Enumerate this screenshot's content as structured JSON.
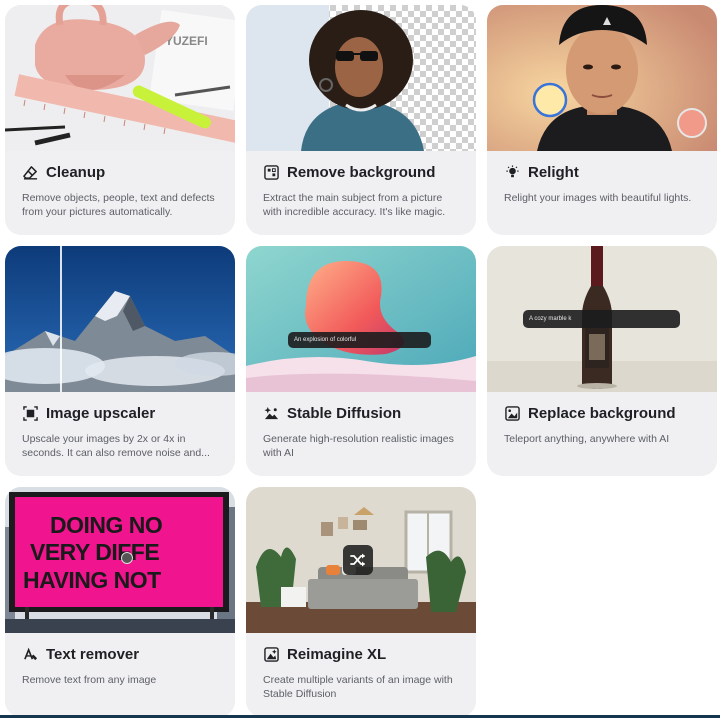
{
  "tools": [
    {
      "title": "Cleanup",
      "icon": "eraser-icon",
      "description": "Remove objects, people, text and defects from your pictures automatically."
    },
    {
      "title": "Remove background",
      "icon": "background-remove-icon",
      "description": "Extract the main subject from a picture with incredible accuracy. It's like magic."
    },
    {
      "title": "Relight",
      "icon": "lightbulb-icon",
      "description": "Relight your images with beautiful lights."
    },
    {
      "title": "Image upscaler",
      "icon": "upscale-icon",
      "description": "Upscale your images by 2x or 4x in seconds. It can also remove noise and..."
    },
    {
      "title": "Stable Diffusion",
      "icon": "image-sparkle-icon",
      "description": "Generate high-resolution realistic images with AI",
      "prompt": "An explosion of colorful"
    },
    {
      "title": "Replace background",
      "icon": "image-replace-icon",
      "description": "Teleport anything, anywhere with AI",
      "prompt": "A cozy marble k"
    },
    {
      "title": "Text remover",
      "icon": "text-erase-icon",
      "description": "Remove text from any image",
      "billboard": [
        "DOING NO",
        "VERY DIFFE",
        "HAVING NOT"
      ]
    },
    {
      "title": "Reimagine XL",
      "icon": "image-variants-icon",
      "description": "Create multiple variants of an image with Stable Diffusion"
    }
  ],
  "colors": {
    "card_bg": "#f0f0f2",
    "title": "#1f2024",
    "description": "#5c5f66",
    "billboard": "#f0148f"
  }
}
